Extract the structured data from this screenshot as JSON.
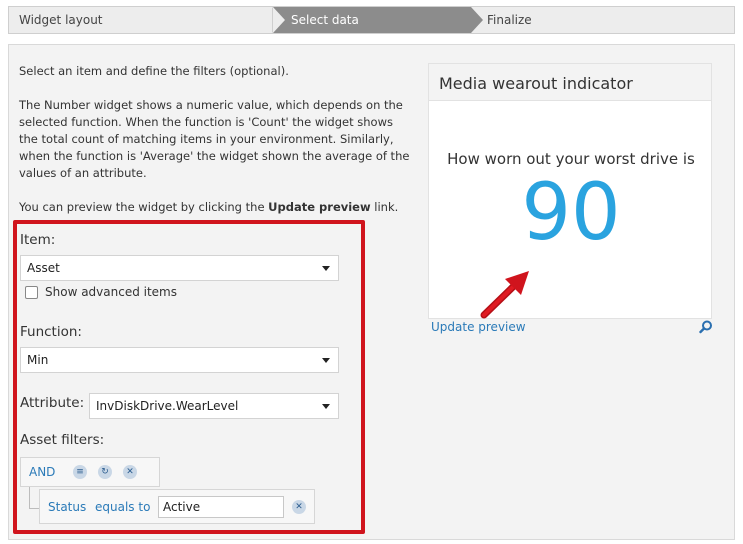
{
  "steps": [
    {
      "label": "Widget layout",
      "active": false
    },
    {
      "label": "Select data",
      "active": true
    },
    {
      "label": "Finalize",
      "active": false
    }
  ],
  "intro": {
    "line1": "Select an item and define the filters (optional).",
    "line2": "The Number widget shows a numeric value, which depends on the selected function. When the function is 'Count' the widget shows the total count of matching items in your environment. Similarly, when the function is 'Average' the widget shown the average of the values of an attribute.",
    "line3_pre": "You can preview the widget by clicking the ",
    "line3_bold": "Update preview",
    "line3_post": " link."
  },
  "form": {
    "item_label": "Item:",
    "item_value": "Asset",
    "show_advanced_label": "Show advanced items",
    "show_advanced_checked": false,
    "function_label": "Function:",
    "function_value": "Min",
    "attribute_label": "Attribute:",
    "attribute_value": "InvDiskDrive.WearLevel",
    "asset_filters_label": "Asset filters:",
    "logic_operator": "AND",
    "filter": {
      "field": "Status",
      "operator": "equals to",
      "value": "Active"
    }
  },
  "preview": {
    "title": "Media wearout indicator",
    "subtitle": "How worn out your worst drive is",
    "value": "90",
    "update_link": "Update preview"
  },
  "colors": {
    "accent": "#2aa3df",
    "link": "#2a7ab8",
    "highlight": "#d0141d",
    "active_step": "#8c8c8c"
  }
}
